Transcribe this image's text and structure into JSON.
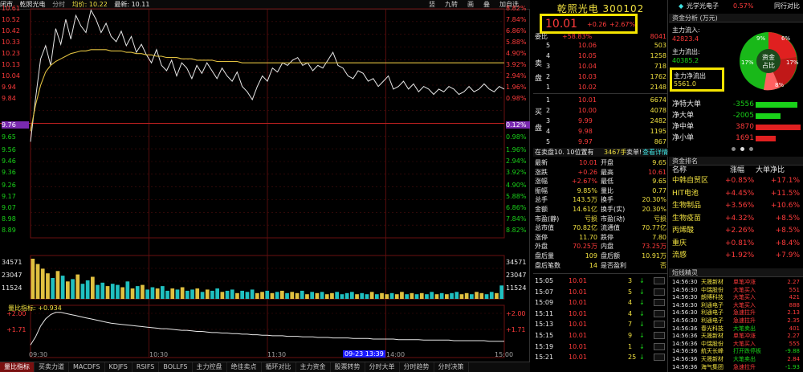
{
  "chart_header": {
    "title": "闭市",
    "stock": "乾照光电",
    "period": "分时",
    "avg_label": "均价: 10.22",
    "latest_label": "最新: 10.11",
    "tools": [
      "竖",
      "九转",
      "画",
      "叠",
      "加自选"
    ]
  },
  "y_left": [
    "10.61",
    "10.52",
    "10.42",
    "10.33",
    "10.23",
    "10.13",
    "10.04",
    "9.94",
    "9.84",
    "9.76",
    "9.65",
    "9.56",
    "9.46",
    "9.36",
    "9.26",
    "9.17",
    "9.07",
    "8.98",
    "8.89",
    "34571",
    "23047",
    "11524"
  ],
  "y_right": [
    "8.82%",
    "7.84%",
    "6.86%",
    "5.88%",
    "4.90%",
    "3.92%",
    "2.94%",
    "1.96%",
    "0.98%",
    "0.12%",
    "0.98%",
    "1.96%",
    "2.94%",
    "3.92%",
    "4.90%",
    "5.88%",
    "6.86%",
    "7.84%",
    "8.82%",
    "34571",
    "23047",
    "11524"
  ],
  "ind_left": [
    "+2.00",
    "+1.71"
  ],
  "ind_right": [
    "+2.00",
    "+1.71"
  ],
  "indicator_label": "量比指标: +0.934",
  "x_labels": [
    "09:30",
    "10:30",
    "11:30",
    "14:00",
    "15:00"
  ],
  "time_tag": "09-23 13:39",
  "bottom_tabs": [
    "量比指标",
    "买卖力道",
    "MACDFS",
    "KDJFS",
    "RSIFS",
    "BOLLFS",
    "主力控盘",
    "绝佳卖点",
    "循环对比",
    "主力资金",
    "股票转势",
    "分时大单",
    "分时趋势",
    "分时决策"
  ],
  "chart_data": {
    "type": "line",
    "title": "",
    "ylim": [
      8.89,
      10.63
    ],
    "prev_close": 9.76,
    "x_ticks": [
      "09:30",
      "10:30",
      "11:30",
      "14:00",
      "15:00"
    ],
    "series": [
      {
        "name": "",
        "values": [
          9.62,
          9.95,
          10.25,
          10.35,
          10.2,
          10.48,
          10.36,
          10.55,
          10.4,
          10.58,
          10.5,
          10.45,
          10.62,
          10.55,
          10.45,
          10.52,
          10.42,
          10.38,
          10.46,
          10.35,
          10.42,
          10.3,
          10.36,
          10.28,
          10.22,
          10.32,
          10.2,
          10.16,
          10.24,
          10.12,
          10.22,
          10.18,
          10.1,
          10.2,
          10.14,
          10.22,
          10.16,
          10.1,
          10.18,
          10.12,
          10.08,
          10.15,
          10.04,
          10.0,
          9.94,
          10.04,
          10.12,
          10.08,
          10.18,
          10.15,
          10.22,
          10.2,
          10.24,
          10.26,
          10.2,
          10.22,
          10.16,
          10.2,
          10.18,
          10.24,
          10.3,
          10.2,
          10.18,
          10.12,
          10.1,
          10.16,
          10.14,
          10.08,
          10.1,
          10.04,
          10.08,
          10.12,
          10.02,
          10.04,
          10.08,
          10.02,
          10.06,
          10.0,
          10.04,
          10.02,
          9.98,
          10.02,
          10.0,
          10.04,
          10.02,
          9.98,
          10.0,
          10.04,
          10.0,
          10.02,
          10.06,
          10.02,
          10.0,
          10.04,
          10.02
        ]
      },
      {
        "name": "",
        "values": [
          9.7,
          9.9,
          10.05,
          10.15,
          10.2,
          10.23,
          10.25,
          10.27,
          10.29,
          10.3,
          10.31,
          10.31,
          10.32,
          10.32,
          10.32,
          10.32,
          10.31,
          10.31,
          10.31,
          10.3,
          10.3,
          10.29,
          10.29,
          10.28,
          10.28,
          10.27,
          10.27,
          10.26,
          10.26,
          10.26,
          10.25,
          10.25,
          10.25,
          10.24,
          10.24,
          10.24,
          10.24,
          10.23,
          10.23,
          10.23,
          10.23,
          10.23,
          10.22,
          10.22,
          10.22,
          10.22,
          10.22,
          10.22,
          10.22,
          10.22,
          10.22,
          10.22,
          10.22,
          10.22,
          10.22,
          10.22,
          10.22,
          10.22,
          10.22,
          10.22,
          10.22,
          10.22,
          10.22,
          10.22,
          10.22,
          10.22,
          10.22,
          10.22,
          10.22,
          10.22,
          10.22,
          10.22,
          10.22,
          10.22,
          10.22,
          10.22,
          10.22,
          10.22,
          10.22,
          10.22,
          10.22,
          10.22,
          10.22,
          10.22,
          10.22,
          10.22,
          10.22,
          10.22,
          10.22,
          10.22,
          10.22,
          10.22,
          10.22,
          10.22,
          10.22
        ]
      }
    ],
    "volume": [
      34571,
      30000,
      26000,
      22000,
      18000,
      24000,
      20000,
      15000,
      17000,
      21000,
      13000,
      16000,
      19000,
      12000,
      14000,
      11000,
      13000,
      12000,
      10000,
      15000,
      9000,
      11000,
      12000,
      8000,
      10000,
      9000,
      11000,
      7000,
      9000,
      8000,
      10000,
      7000,
      8000,
      9000,
      6000,
      8000,
      7000,
      9000,
      6000,
      7000,
      8000,
      5000,
      7000,
      6000,
      8000,
      5000,
      6000,
      7000,
      5000,
      6000,
      7000,
      5000,
      6000,
      5000,
      7000,
      4000,
      6000,
      5000,
      6000,
      4000,
      5000,
      6000,
      4000,
      5000,
      6000,
      4000,
      5000,
      4000,
      6000,
      4000,
      5000,
      4000,
      5000,
      4000,
      6000,
      4000,
      5000,
      4000,
      5000,
      4000,
      6000,
      4000,
      5000,
      4000,
      5000,
      6000,
      4000,
      5000,
      4000,
      6000,
      5000,
      4000,
      6000,
      5000,
      11524
    ],
    "indicator": [
      1.4,
      1.55,
      1.75,
      1.88,
      1.96,
      2.0,
      2.0,
      1.98,
      1.96,
      1.94,
      1.92,
      1.9,
      1.88,
      1.86,
      1.84,
      1.82,
      1.8,
      1.79,
      1.78,
      1.77,
      1.76,
      1.75,
      1.74,
      1.73,
      1.72,
      1.71,
      1.7,
      1.7,
      1.69,
      1.68,
      1.67,
      1.67,
      1.66,
      1.65,
      1.65,
      1.64,
      1.63,
      1.63,
      1.62,
      1.62,
      1.61,
      1.61,
      1.6,
      1.6,
      1.59,
      1.59,
      1.58,
      1.58,
      1.57,
      1.57,
      1.57,
      1.56,
      1.56,
      1.56,
      1.55,
      1.55,
      1.55,
      1.54,
      1.54,
      1.54,
      1.53,
      1.53,
      1.53,
      1.53,
      1.52,
      1.52,
      1.52,
      1.52,
      1.51,
      1.51,
      1.51,
      1.51,
      1.51,
      1.5,
      1.5,
      1.5,
      1.5,
      1.5,
      1.49,
      1.49,
      1.49,
      1.49,
      1.49,
      1.49,
      1.48,
      1.48,
      1.48,
      1.48,
      1.48,
      1.48,
      1.48,
      1.47,
      1.47,
      1.47,
      1.47
    ]
  },
  "quote": {
    "title": "乾照光电 300102",
    "price": "10.01",
    "change": "+0.26",
    "change_pct": "+2.67%",
    "weibi_label": "委比",
    "weibi_value": "+58.83%",
    "weicha": "8041",
    "sell_label": "卖",
    "sell_label2": "盘",
    "buy_label": "买",
    "buy_label2": "盘",
    "asks": [
      {
        "lvl": "5",
        "price": "10.06",
        "vol": "503"
      },
      {
        "lvl": "4",
        "price": "10.05",
        "vol": "1258"
      },
      {
        "lvl": "3",
        "price": "10.04",
        "vol": "718"
      },
      {
        "lvl": "2",
        "price": "10.03",
        "vol": "1762"
      },
      {
        "lvl": "1",
        "price": "10.02",
        "vol": "2148"
      }
    ],
    "bids": [
      {
        "lvl": "1",
        "price": "10.01",
        "vol": "6674"
      },
      {
        "lvl": "2",
        "price": "10.00",
        "vol": "4078"
      },
      {
        "lvl": "3",
        "price": "9.99",
        "vol": "2482"
      },
      {
        "lvl": "4",
        "price": "9.98",
        "vol": "1195"
      },
      {
        "lvl": "5",
        "price": "9.97",
        "vol": "867"
      }
    ],
    "bar_left": "在卖盘10. 10位置有",
    "bar_mid": "3467手",
    "bar_right": "卖单!",
    "bar_link": "查看详情",
    "stats": [
      [
        "最新",
        "10.01",
        "开盘",
        "9.65"
      ],
      [
        "涨跌",
        "+0.26",
        "最高",
        "10.61"
      ],
      [
        "涨幅",
        "+2.67%",
        "最低",
        "9.65"
      ],
      [
        "振幅",
        "9.85%",
        "量比",
        "0.77"
      ],
      [
        "总手",
        "143.5万",
        "换手",
        "20.30%"
      ],
      [
        "金额",
        "14.61亿",
        "换手(实)",
        "20.30%"
      ],
      [
        "市盈(静)",
        "亏损",
        "市盈(动)",
        "亏损"
      ],
      [
        "总市值",
        "70.82亿",
        "流通值",
        "70.77亿"
      ],
      [
        "涨停",
        "11.70",
        "跌停",
        "7.80"
      ],
      [
        "外盘",
        "70.25万",
        "内盘",
        "73.25万"
      ],
      [
        "盘后量",
        "109",
        "盘后额",
        "10.91万"
      ],
      [
        "盘后笔数",
        "14",
        "是否盈利",
        "否"
      ]
    ],
    "ticks": [
      [
        "15:05",
        "10.01",
        "3"
      ],
      [
        "15:07",
        "10.01",
        "5"
      ],
      [
        "15:09",
        "10.01",
        "4"
      ],
      [
        "15:11",
        "10.01",
        "4"
      ],
      [
        "15:13",
        "10.01",
        "7"
      ],
      [
        "15:15",
        "10.01",
        "9"
      ],
      [
        "15:19",
        "10.01",
        "1"
      ],
      [
        "15:21",
        "10.01",
        "25"
      ]
    ]
  },
  "right": {
    "sector": "光学光电子",
    "sector_change": "0.57%",
    "sector_link": "同行对比",
    "fund_head": "资金分析 (万元)",
    "main_in_label": "主力流入:",
    "main_in": "42823.4",
    "main_out_label": "主力流出:",
    "main_out": "40385.2",
    "net_label": "主力净流出",
    "net_value": "5561.0",
    "pie_center_1": "资金",
    "pie_center_2": "占比",
    "pie_labels": [
      "9%",
      "6%",
      "17%",
      "17%",
      "8%"
    ],
    "bars": [
      {
        "label": "净特大单",
        "value": "-3556",
        "color": "#19d219",
        "frac": 0.92
      },
      {
        "label": "净大单",
        "value": "-2005",
        "color": "#19d219",
        "frac": 0.55
      },
      {
        "label": "净中单",
        "value": "3870",
        "color": "#e02020",
        "frac": 1.0
      },
      {
        "label": "净小单",
        "value": "1691",
        "color": "#e02020",
        "frac": 0.45
      }
    ],
    "rank_head": "资金排名",
    "rank_cols": [
      "名称",
      "涨幅",
      "大单净比"
    ],
    "ranks": [
      [
        "中韩自贸区",
        "+0.85%",
        "+17.1%"
      ],
      [
        "HIT电池",
        "+4.45%",
        "+11.5%"
      ],
      [
        "生物制品",
        "+3.56%",
        "+10.6%"
      ],
      [
        "生物疫苗",
        "+4.32%",
        "+8.5%"
      ],
      [
        "丙烯酸",
        "+2.26%",
        "+8.5%"
      ],
      [
        "重庆",
        "+0.81%",
        "+8.4%"
      ],
      [
        "流感",
        "+1.92%",
        "+7.9%"
      ]
    ],
    "radar_head": "短线精灵",
    "radar": [
      [
        "14:56:30",
        "天晟新材",
        "单笔冲涨",
        "2.27"
      ],
      [
        "14:56:30",
        "中瑞股份",
        "大笔买入",
        "551"
      ],
      [
        "14:56:30",
        "朗博科技",
        "大笔买入",
        "421"
      ],
      [
        "14:56:30",
        "利通电子",
        "大笔买入",
        "888"
      ],
      [
        "14:56:30",
        "利通电子",
        "急速拉升",
        "2.13"
      ],
      [
        "14:56:30",
        "利通电子",
        "急速拉升",
        "2.35"
      ],
      [
        "14:56:36",
        "春光科技",
        "大笔卖出",
        "401"
      ],
      [
        "14:56:36",
        "天晟新材",
        "单笔冲涨",
        "2.27"
      ],
      [
        "14:56:36",
        "中瑞股份",
        "大笔买入",
        "555"
      ],
      [
        "14:56:36",
        "航天长峰",
        "打开跌停板",
        "-9.88"
      ],
      [
        "14:56:36",
        "天晟新材",
        "大笔卖出",
        "2.84"
      ],
      [
        "14:56:36",
        "海气集团",
        "急速拉升",
        "-1.93"
      ]
    ]
  }
}
